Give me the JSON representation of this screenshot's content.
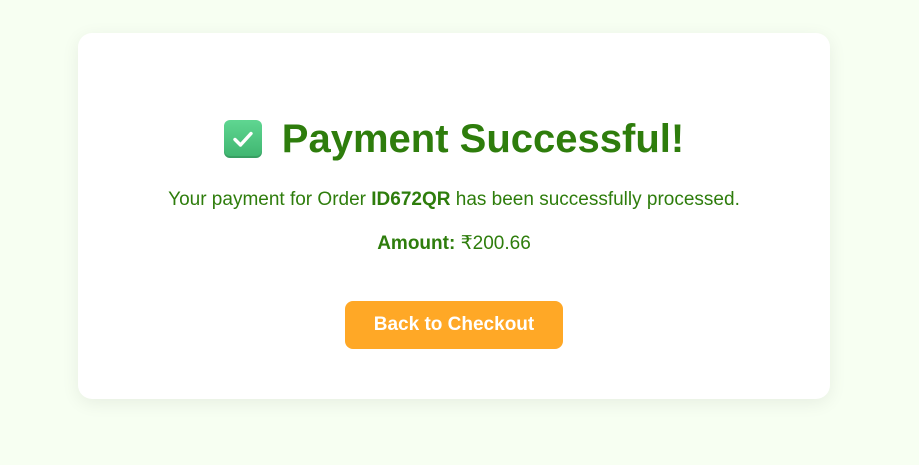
{
  "success": {
    "icon": "check-mark-button-icon",
    "title": "Payment Successful!",
    "message_prefix": "Your payment for Order ",
    "order_id": "ID672QR",
    "message_suffix": " has been successfully processed.",
    "amount_label": "Amount:",
    "amount_value": " ₹200.66",
    "button_label": "Back to Checkout"
  },
  "colors": {
    "background": "#f7fff2",
    "card": "#ffffff",
    "text_green": "#2e7d0c",
    "button": "#ffa826",
    "icon_green": "#4cc57e"
  }
}
